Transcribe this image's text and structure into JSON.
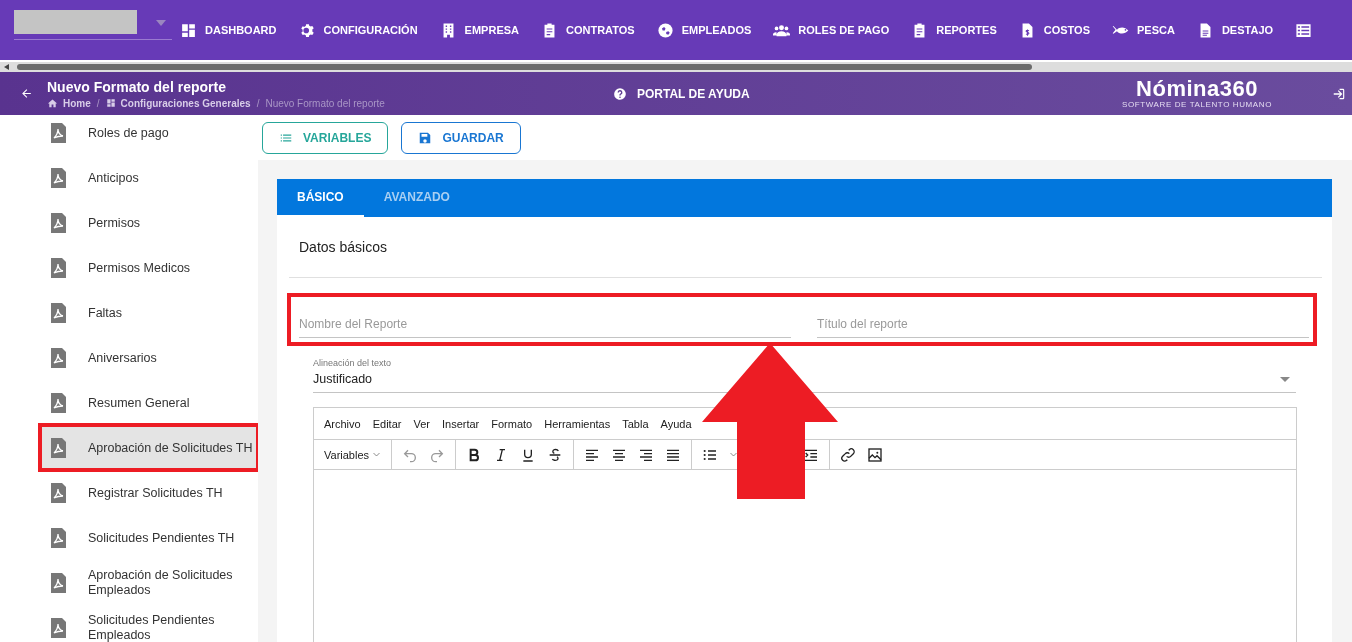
{
  "top_nav": {
    "items": [
      {
        "label": "DASHBOARD"
      },
      {
        "label": "CONFIGURACIÓN"
      },
      {
        "label": "EMPRESA"
      },
      {
        "label": "CONTRATOS"
      },
      {
        "label": "EMPLEADOS"
      },
      {
        "label": "ROLES DE PAGO"
      },
      {
        "label": "REPORTES"
      },
      {
        "label": "COSTOS"
      },
      {
        "label": "PESCA"
      },
      {
        "label": "DESTAJO"
      }
    ]
  },
  "header": {
    "title": "Nuevo Formato del reporte",
    "breadcrumbs": [
      {
        "label": "Home",
        "current": false
      },
      {
        "label": "Configuraciones Generales",
        "current": false
      },
      {
        "label": "Nuevo Formato del reporte",
        "current": true
      }
    ],
    "breadcrumb_separator": "/",
    "help_link": "PORTAL DE AYUDA",
    "logo": {
      "name": "Nómina360",
      "tagline": "SOFTWARE DE TALENTO HUMANO"
    }
  },
  "sidebar": {
    "items": [
      {
        "label": "Roles de pago",
        "selected": false,
        "highlighted": false
      },
      {
        "label": "Anticipos",
        "selected": false,
        "highlighted": false
      },
      {
        "label": "Permisos",
        "selected": false,
        "highlighted": false
      },
      {
        "label": "Permisos Medicos",
        "selected": false,
        "highlighted": false
      },
      {
        "label": "Faltas",
        "selected": false,
        "highlighted": false
      },
      {
        "label": "Aniversarios",
        "selected": false,
        "highlighted": false
      },
      {
        "label": "Resumen General",
        "selected": false,
        "highlighted": false
      },
      {
        "label": "Aprobación de Solicitudes TH",
        "selected": true,
        "highlighted": true
      },
      {
        "label": "Registrar Solicitudes TH",
        "selected": false,
        "highlighted": false
      },
      {
        "label": "Solicitudes Pendientes TH",
        "selected": false,
        "highlighted": false
      },
      {
        "label": "Aprobación de Solicitudes Empleados",
        "selected": false,
        "highlighted": false
      },
      {
        "label": "Solicitudes Pendientes Empleados",
        "selected": false,
        "highlighted": false
      }
    ]
  },
  "actions": [
    {
      "label": "VARIABLES",
      "kind": "secondary"
    },
    {
      "label": "GUARDAR",
      "kind": "primary"
    }
  ],
  "tabs": [
    {
      "label": "BÁSICO",
      "selected": true
    },
    {
      "label": "AVANZADO",
      "selected": false
    }
  ],
  "section_title": "Datos básicos",
  "fields": {
    "highlighted": true,
    "items": [
      {
        "placeholder": "Nombre del Reporte"
      },
      {
        "placeholder": "Título del reporte"
      }
    ]
  },
  "alignment_select": {
    "label": "Alineación del texto",
    "value": "Justificado"
  },
  "editor": {
    "menu": [
      "Archivo",
      "Editar",
      "Ver",
      "Insertar",
      "Formato",
      "Herramientas",
      "Tabla",
      "Ayuda"
    ],
    "variables_dropdown": "Variables"
  },
  "pointer_arrow": true
}
